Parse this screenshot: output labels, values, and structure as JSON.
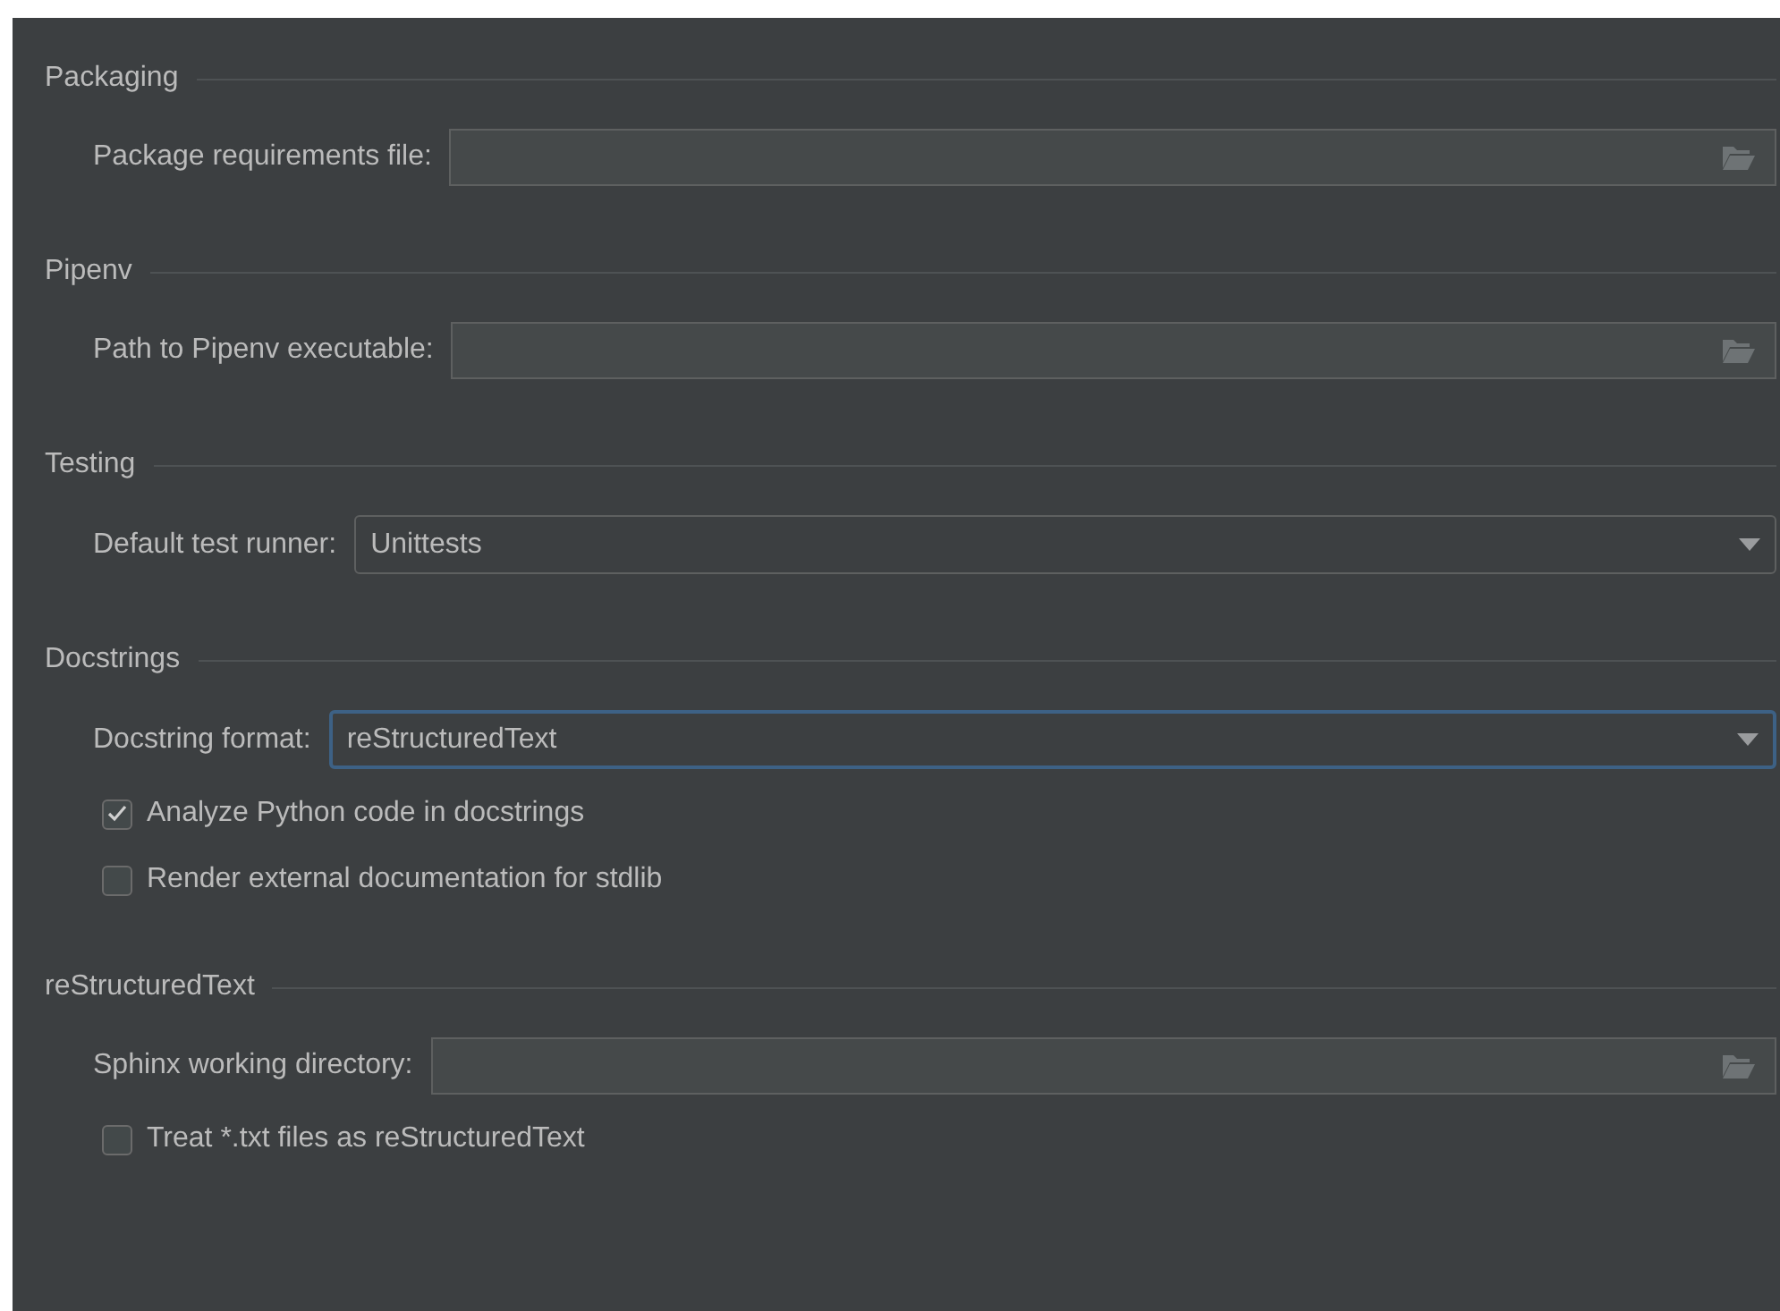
{
  "sections": [
    {
      "title": "Packaging",
      "items": [
        {
          "kind": "path",
          "label": "Package requirements file:"
        }
      ]
    },
    {
      "title": "Pipenv",
      "items": [
        {
          "kind": "path",
          "label": "Path to Pipenv executable:"
        }
      ]
    },
    {
      "title": "Testing",
      "items": [
        {
          "kind": "combo",
          "label": "Default test runner:",
          "value": "Unittests",
          "focused": false
        }
      ]
    },
    {
      "title": "Docstrings",
      "items": [
        {
          "kind": "combo",
          "label": "Docstring format:",
          "value": "reStructuredText",
          "focused": true
        },
        {
          "kind": "checkbox",
          "label": "Analyze Python code in docstrings",
          "checked": true
        },
        {
          "kind": "checkbox",
          "label": "Render external documentation for stdlib",
          "checked": false
        }
      ]
    },
    {
      "title": "reStructuredText",
      "items": [
        {
          "kind": "path",
          "label": "Sphinx working directory:"
        },
        {
          "kind": "checkbox",
          "label": "Treat *.txt files as reStructuredText",
          "checked": false
        }
      ]
    }
  ]
}
